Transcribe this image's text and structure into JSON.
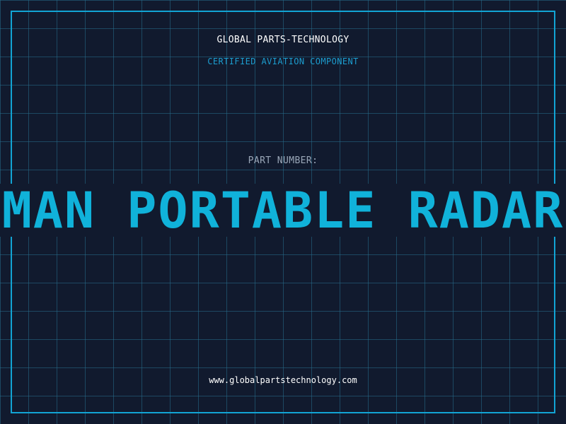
{
  "brand": {
    "name": "GLOBAL PARTS-TECHNOLOGY",
    "tagline": "CERTIFIED AVIATION COMPONENT"
  },
  "part": {
    "label": "PART NUMBER:",
    "title": "MAN PORTABLE RADAR"
  },
  "footer": {
    "website": "www.globalpartstechnology.com"
  },
  "colors": {
    "background": "#111a2e",
    "grid": "#266e8c",
    "frame": "#12a4d4",
    "accent": "#10b2da"
  }
}
